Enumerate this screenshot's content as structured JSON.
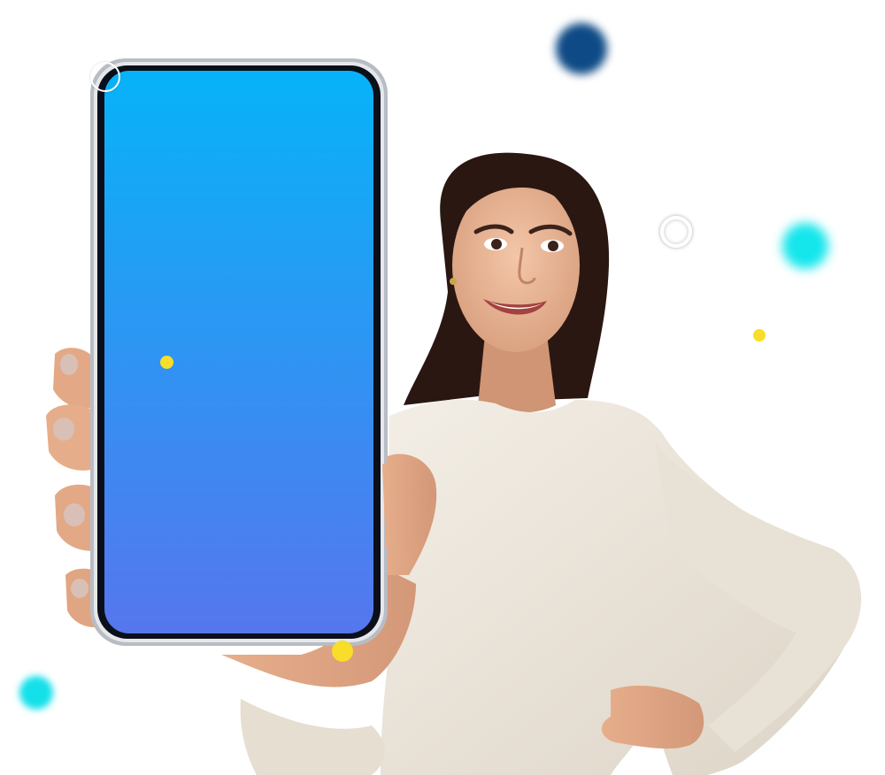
{
  "colors": {
    "background": "#ffffff",
    "screen_gradient_top": "#07b3f8",
    "screen_gradient_bottom": "#5676ee",
    "sweater": "#ece6db",
    "skin": "#e8b392",
    "hair": "#2a1712",
    "accent_cyan": "#14e6ec",
    "accent_navy": "#0e4a86",
    "accent_yellow": "#f8dd2a"
  },
  "scene": {
    "subject": "woman-holding-smartphone",
    "phone_screen": "blank-gradient"
  }
}
